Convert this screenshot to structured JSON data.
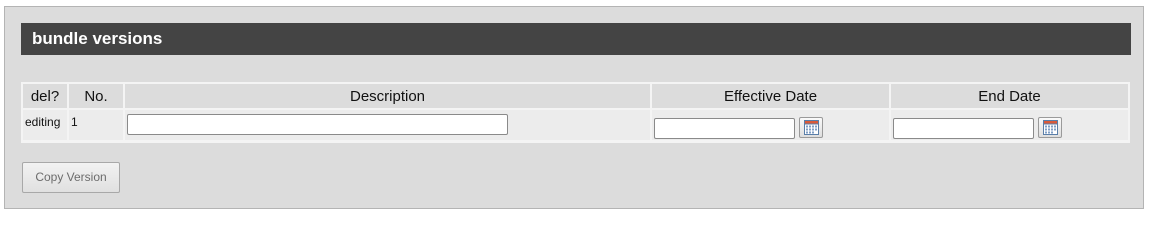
{
  "section": {
    "title": "bundle versions"
  },
  "table": {
    "columns": [
      "del?",
      "No.",
      "Description",
      "Effective Date",
      "End Date"
    ],
    "rows": [
      {
        "del": "editing",
        "no": "1",
        "description": "",
        "effective_date": "",
        "end_date": ""
      }
    ]
  },
  "actions": {
    "copy_version": "Copy Version"
  },
  "icons": {
    "calendar": "calendar-icon"
  }
}
